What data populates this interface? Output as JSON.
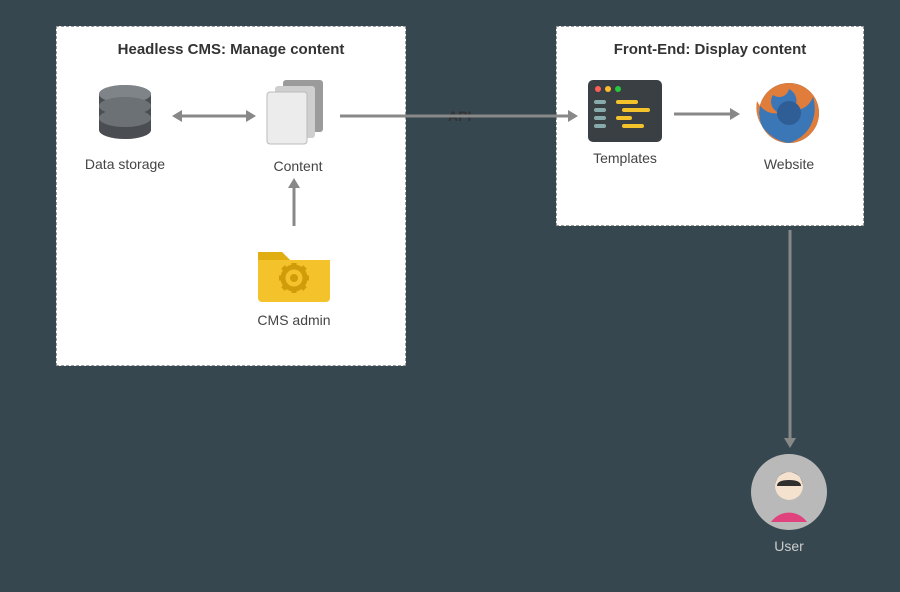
{
  "panels": {
    "left_title": "Headless CMS: Manage content",
    "right_title": "Front-End: Display content"
  },
  "nodes": {
    "data_storage": "Data storage",
    "content": "Content",
    "cms_admin": "CMS admin",
    "templates": "Templates",
    "website": "Website",
    "user": "User"
  },
  "edges": {
    "api_label": "API"
  },
  "diagram": {
    "description": "Headless CMS architecture. In the CMS box: Data storage <-> Content, CMS admin -> Content. Content -> (API) -> Templates -> Website. Website -> User.",
    "arrows": [
      {
        "from": "data_storage",
        "to": "content",
        "dir": "both"
      },
      {
        "from": "cms_admin",
        "to": "content",
        "dir": "forward"
      },
      {
        "from": "content",
        "to": "templates",
        "dir": "forward",
        "label": "API"
      },
      {
        "from": "templates",
        "to": "website",
        "dir": "forward"
      },
      {
        "from": "website",
        "to": "user",
        "dir": "forward"
      }
    ]
  }
}
